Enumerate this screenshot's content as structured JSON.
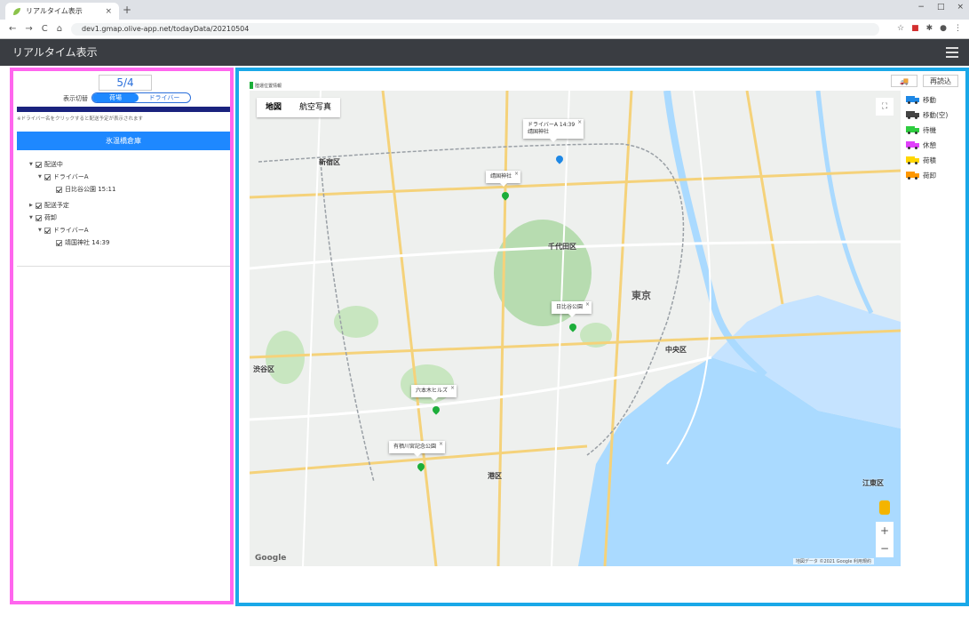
{
  "browser": {
    "tab_title": "リアルタイム表示",
    "tab_close": "×",
    "new_tab": "+",
    "url": "dev1.gmap.olive-app.net/todayData/20210504",
    "nav": {
      "back": "←",
      "forward": "→",
      "reload": "C",
      "home": "⌂"
    },
    "window_controls": {
      "minimize": "−",
      "maximize": "□",
      "close": "×"
    }
  },
  "app": {
    "title": "リアルタイム表示"
  },
  "left_panel": {
    "date": "5/4",
    "mode_label": "表示切替",
    "mode_on": "荷場",
    "mode_off": "ドライバー",
    "note": "※ドライバー名をクリックすると配送予定が表示されます",
    "depot_button": "氷温橋倉庫",
    "tree": {
      "in_delivery": "配送中",
      "driver_a_1": "ドライバーA",
      "stop_1": "日比谷公園 15:11",
      "scheduled": "配送予定",
      "unload": "荷卸",
      "driver_a_2": "ドライバーA",
      "stop_2": "靖国神社 14:39"
    }
  },
  "right_panel": {
    "legend_top": "陸運位置情報",
    "truck_button": "🚚",
    "reload_button": "再読込",
    "map_tabs": {
      "map": "地図",
      "satellite": "航空写真"
    },
    "fullscreen": "⛶",
    "zoom_in": "+",
    "zoom_out": "−",
    "google": "Google",
    "attribution": "地図データ ©2021 Google 利用規約",
    "map_labels": {
      "shinjuku": "新宿区",
      "chiyoda": "千代田区",
      "chuo": "中央区",
      "shibuya": "渋谷区",
      "minato": "港区",
      "koto": "江東区",
      "tokyo": "東京"
    },
    "popups": {
      "p1_line1": "ドライバーA 14:39",
      "p1_line2": "靖国神社",
      "p2": "靖国神社",
      "p3": "日比谷公園",
      "p4": "六本木ヒルズ",
      "p5": "有栖川宮記念公園",
      "close": "×"
    },
    "legend": [
      {
        "label": "移動",
        "color": "#1e88e5"
      },
      {
        "label": "移動(空)",
        "color": "#444444"
      },
      {
        "label": "待機",
        "color": "#2ecc40"
      },
      {
        "label": "休憩",
        "color": "#e040fb"
      },
      {
        "label": "荷積",
        "color": "#ffd600"
      },
      {
        "label": "荷卸",
        "color": "#ff9800"
      }
    ]
  }
}
